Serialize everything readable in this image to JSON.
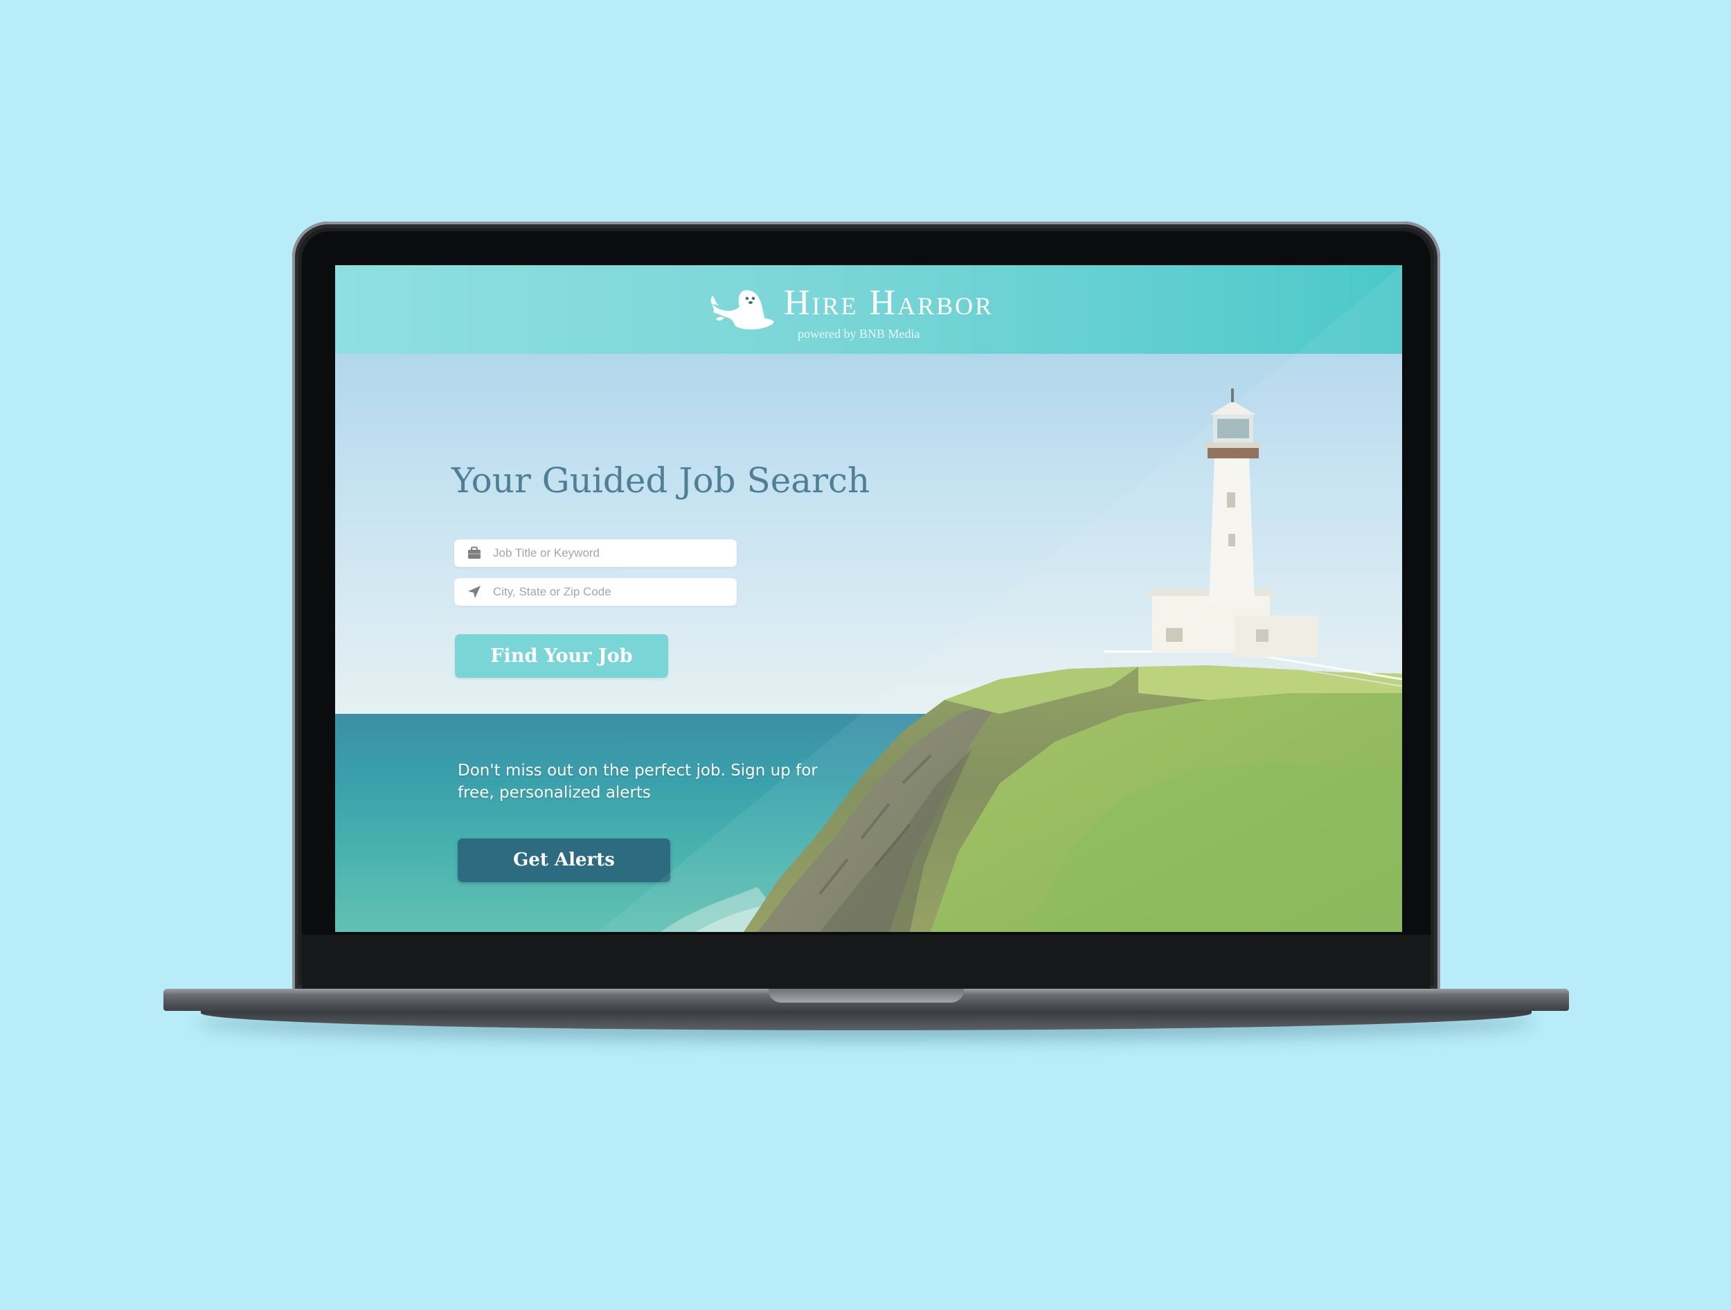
{
  "brand": {
    "name": "Hire Harbor",
    "tagline": "powered by BNB Media",
    "logo_icon": "seal-icon"
  },
  "hero": {
    "title": "Your Guided Job Search"
  },
  "search": {
    "keyword_placeholder": "Job Title or Keyword",
    "keyword_value": "",
    "keyword_icon": "briefcase-icon",
    "location_placeholder": "City, State or Zip Code",
    "location_value": "",
    "location_icon": "location-arrow-icon",
    "submit_label": "Find Your Job"
  },
  "alerts": {
    "text": "Don't miss out on the perfect job. Sign up for free, personalized alerts",
    "button_label": "Get Alerts"
  },
  "colors": {
    "background": "#b8ecf8",
    "accent": "#7ad5d6",
    "header": "#6fd3d4",
    "title_text": "#4f7f95",
    "alerts_button": "#2c6b80"
  }
}
